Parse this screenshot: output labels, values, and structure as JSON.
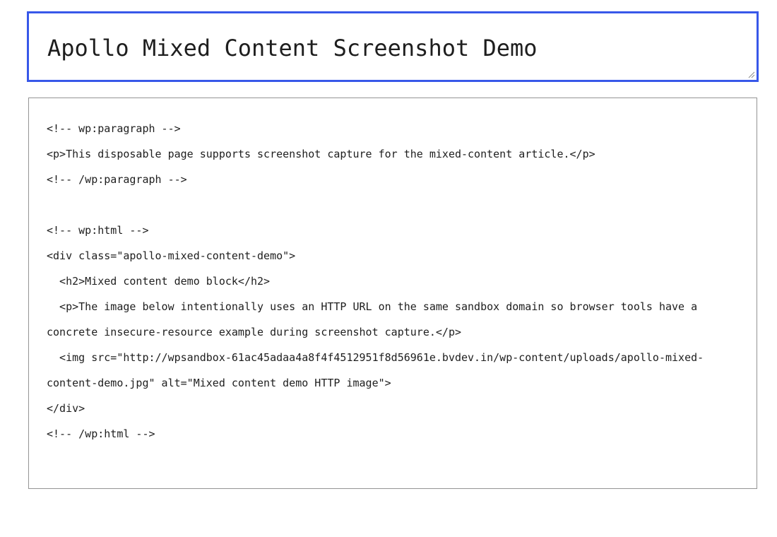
{
  "post_title": {
    "value": "Apollo Mixed Content Screenshot Demo"
  },
  "code_editor": {
    "lines": [
      "<!-- wp:paragraph -->",
      "<p>This disposable page supports screenshot capture for the mixed-content article.</p>",
      "<!-- /wp:paragraph -->",
      "",
      "<!-- wp:html -->",
      "<div class=\"apollo-mixed-content-demo\">",
      "  <h2>Mixed content demo block</h2>",
      "  <p>The image below intentionally uses an HTTP URL on the same sandbox domain so browser tools have a",
      "concrete insecure-resource example during screenshot capture.</p>",
      "  <img src=\"http://wpsandbox-61ac45adaa4a8f4f4512951f8d56961e.bvdev.in/wp-content/uploads/apollo-mixed-",
      "content-demo.jpg\" alt=\"Mixed content demo HTTP image\">",
      "</div>",
      "<!-- /wp:html -->"
    ]
  },
  "colors": {
    "focus_border": "#3858e9",
    "editor_border": "#949494",
    "text": "#1e1e1e"
  }
}
